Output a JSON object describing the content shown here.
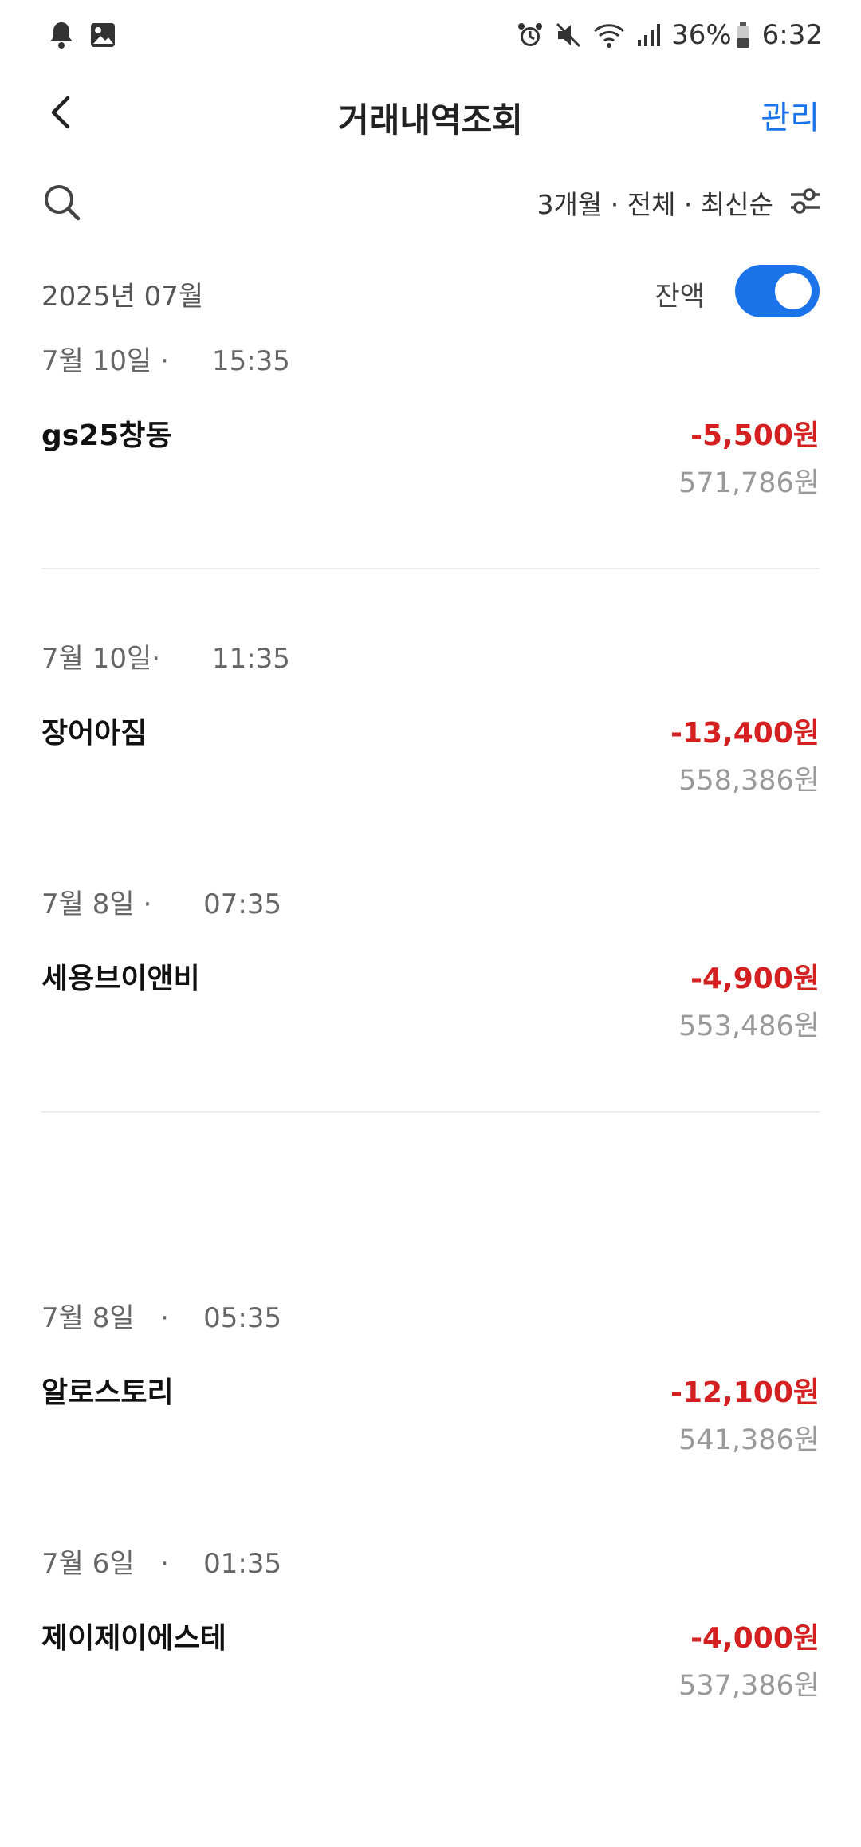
{
  "status_bar": {
    "battery_percent": "36%",
    "time": "6:32"
  },
  "header": {
    "title": "거래내역조회",
    "manage_label": "관리"
  },
  "filter": {
    "label": "3개월 · 전체 · 최신순"
  },
  "month": {
    "label": "2025년 07월",
    "balance_toggle_label": "잔액",
    "balance_toggle_on": true
  },
  "colors": {
    "accent": "#1a73e8",
    "debit": "#d42020"
  },
  "transactions": [
    {
      "date": "7월 10일 ·",
      "time": "15:35",
      "merchant": "gs25창동",
      "amount": "-5,500원",
      "balance": "571,786원"
    },
    {
      "date": "7월 10일·",
      "time": "11:35",
      "merchant": "장어아짐",
      "amount": "-13,400원",
      "balance": "558,386원"
    },
    {
      "date": "7월 8일 ·",
      "time": "07:35",
      "merchant": "세용브이앤비",
      "amount": "-4,900원",
      "balance": "553,486원"
    },
    {
      "date": "7월 8일",
      "time": "·    05:35",
      "merchant": "알로스토리",
      "amount": "-12,100원",
      "balance": "541,386원"
    },
    {
      "date": "7월 6일",
      "time": "·    01:35",
      "merchant": "제이제이에스테",
      "amount": "-4,000원",
      "balance": "537,386원"
    }
  ]
}
